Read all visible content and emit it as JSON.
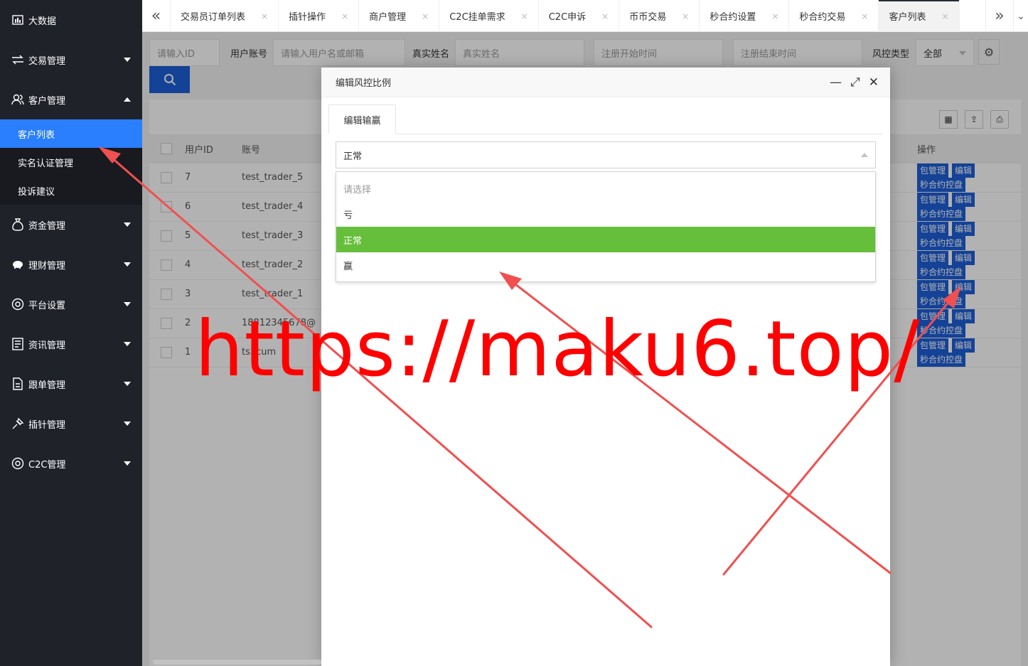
{
  "sidebar": {
    "items": [
      {
        "label": "大数据",
        "icon": "chart-icon",
        "caret": "none"
      },
      {
        "label": "交易管理",
        "icon": "exchange-icon",
        "caret": "down"
      },
      {
        "label": "客户管理",
        "icon": "users-icon",
        "caret": "up"
      },
      {
        "label": "资金管理",
        "icon": "moneybag-icon",
        "caret": "down"
      },
      {
        "label": "理财管理",
        "icon": "piggy-icon",
        "caret": "down"
      },
      {
        "label": "平台设置",
        "icon": "settings-circle-icon",
        "caret": "down"
      },
      {
        "label": "资讯管理",
        "icon": "news-icon",
        "caret": "down"
      },
      {
        "label": "跟单管理",
        "icon": "document-icon",
        "caret": "down"
      },
      {
        "label": "插针管理",
        "icon": "pin-icon",
        "caret": "down"
      },
      {
        "label": "C2C管理",
        "icon": "c2c-icon",
        "caret": "down"
      }
    ],
    "sub_items": [
      "客户列表",
      "实名认证管理",
      "投诉建议"
    ],
    "active_sub": "客户列表"
  },
  "tabs": {
    "items": [
      "交易员订单列表",
      "插针操作",
      "商户管理",
      "C2C挂单需求",
      "C2C申诉",
      "币币交易",
      "秒合约设置",
      "秒合约交易",
      "客户列表"
    ],
    "active": "客户列表",
    "close_glyph": "×"
  },
  "search": {
    "id_placeholder": "请输入ID",
    "account_label": "用户账号",
    "account_placeholder": "请输入用户名或邮箱",
    "realname_label": "真实姓名",
    "realname_placeholder": "真实姓名",
    "start_placeholder": "注册开始时间",
    "end_placeholder": "注册结束时间",
    "risk_label": "风控类型",
    "risk_value": "全部"
  },
  "table": {
    "headers": {
      "id": "用户ID",
      "account": "账号",
      "ops": "操作"
    },
    "rows": [
      {
        "id": "7",
        "account": "test_trader_5"
      },
      {
        "id": "6",
        "account": "test_trader_4"
      },
      {
        "id": "5",
        "account": "test_trader_3"
      },
      {
        "id": "4",
        "account": "test_trader_2"
      },
      {
        "id": "3",
        "account": "test_trader_1"
      },
      {
        "id": "2",
        "account": "18812345678@"
      },
      {
        "id": "1",
        "account": "ts3cum"
      }
    ],
    "ops": {
      "wallet": "包管理",
      "edit": "编辑",
      "control": "秒合约控盘"
    }
  },
  "modal": {
    "title": "编辑风控比例",
    "tab": "编辑输赢",
    "select_value": "正常",
    "options": [
      "请选择",
      "亏",
      "正常",
      "赢"
    ],
    "selected": "正常"
  },
  "watermark": "https://maku6.top/",
  "colors": {
    "sidebar_bg": "#20222a",
    "active_blue": "#2a7fff",
    "btn_blue": "#1e5fd8",
    "selected_green": "#66bf3b",
    "watermark_red": "#ff0000"
  }
}
